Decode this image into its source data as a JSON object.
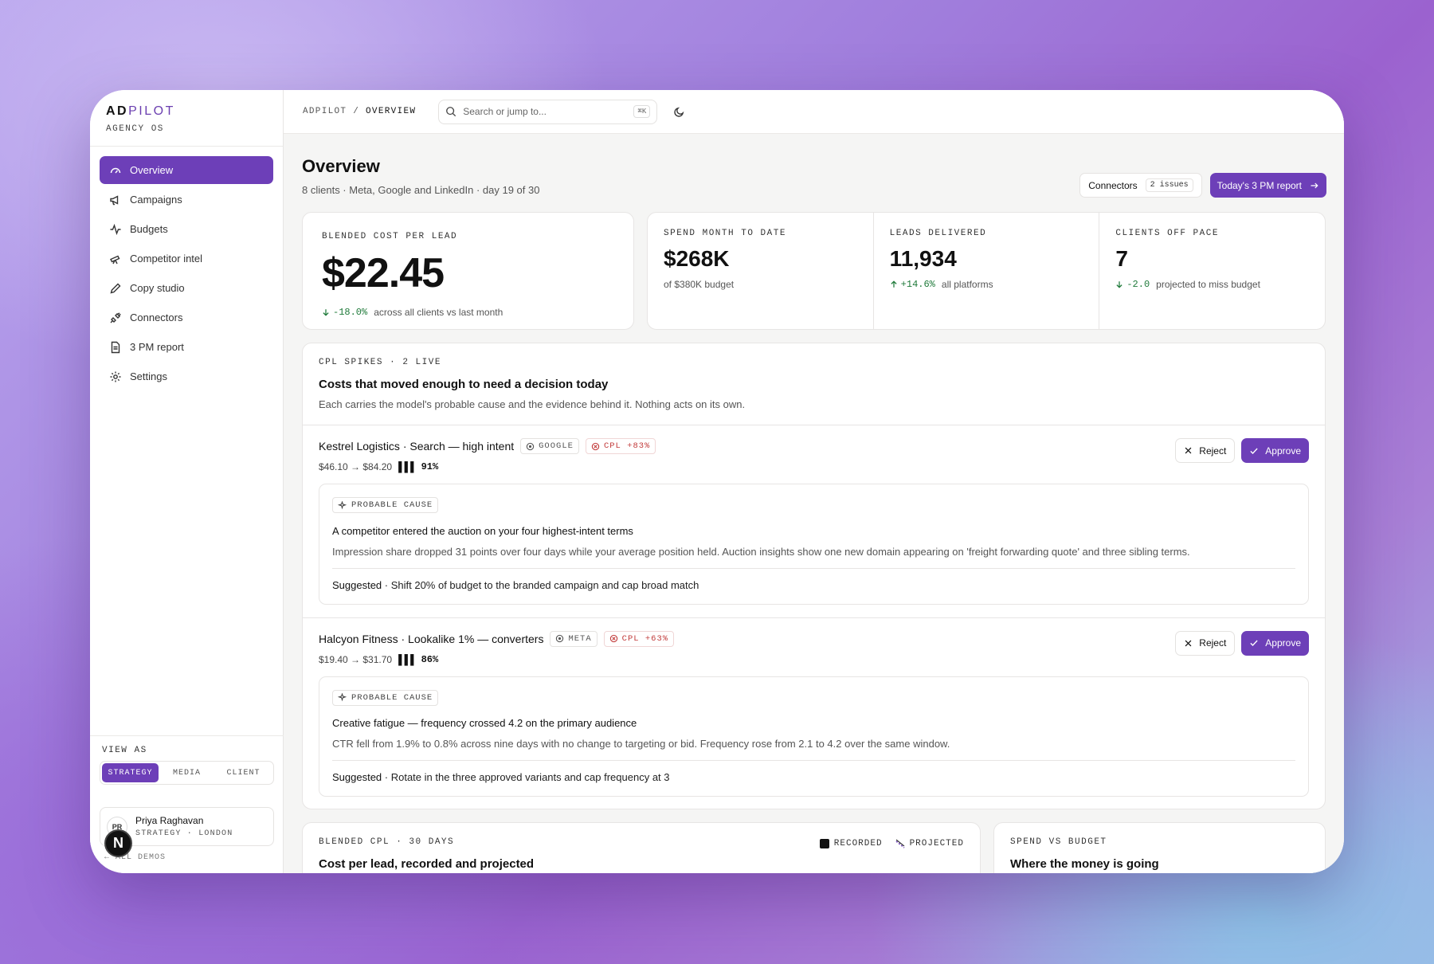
{
  "brand": {
    "name_a": "AD",
    "name_b": "PILOT",
    "tagline": "AGENCY OS"
  },
  "nav": [
    {
      "label": "Overview",
      "icon": "gauge-icon",
      "active": true
    },
    {
      "label": "Campaigns",
      "icon": "megaphone-icon"
    },
    {
      "label": "Budgets",
      "icon": "activity-icon"
    },
    {
      "label": "Competitor intel",
      "icon": "telescope-icon"
    },
    {
      "label": "Copy studio",
      "icon": "pen-icon"
    },
    {
      "label": "Connectors",
      "icon": "plug-icon"
    },
    {
      "label": "3 PM report",
      "icon": "document-icon"
    },
    {
      "label": "Settings",
      "icon": "gear-icon"
    }
  ],
  "view_as": {
    "label": "VIEW AS",
    "options": [
      "STRATEGY",
      "MEDIA",
      "CLIENT"
    ],
    "selected": "STRATEGY"
  },
  "user": {
    "initials": "PR",
    "name": "Priya Raghavan",
    "role": "STRATEGY · LONDON"
  },
  "all_demos": "ALL DEMOS",
  "badge_letter": "N",
  "topbar": {
    "crumb_root": "ADPILOT",
    "crumb_sep": " / ",
    "crumb_page": "OVERVIEW",
    "search_placeholder": "Search or jump to...",
    "shortcut": "⌘K"
  },
  "header": {
    "title": "Overview",
    "subtitle": "8 clients · Meta, Google and LinkedIn · day 19 of 30",
    "connectors_label": "Connectors",
    "connectors_issues": "2 issues",
    "report_button": "Today's 3 PM report"
  },
  "kpis": {
    "cpl": {
      "label": "BLENDED COST PER LEAD",
      "value": "$22.45",
      "delta": "-18.0%",
      "note": "across all clients vs last month"
    },
    "spend": {
      "label": "SPEND MONTH TO DATE",
      "value": "$268K",
      "note": "of $380K budget"
    },
    "leads": {
      "label": "LEADS DELIVERED",
      "value": "11,934",
      "delta": "+14.6%",
      "note": "all platforms"
    },
    "offpace": {
      "label": "CLIENTS OFF PACE",
      "value": "7",
      "delta": "-2.0",
      "note": "projected to miss budget"
    }
  },
  "spikes": {
    "eyebrow": "CPL SPIKES · 2 LIVE",
    "title": "Costs that moved enough to need a decision today",
    "desc": "Each carries the model's probable cause and the evidence behind it. Nothing acts on its own.",
    "items": [
      {
        "name": "Kestrel Logistics · Search — high intent",
        "platform": "GOOGLE",
        "cpl": "CPL +83%",
        "range": "$46.10 → $84.20",
        "confidence": "91%",
        "cause_tag": "PROBABLE CAUSE",
        "cause_head": "A competitor entered the auction on your four highest-intent terms",
        "cause_body": "Impression share dropped 31 points over four days while your average position held. Auction insights show one new domain appearing on 'freight forwarding quote' and three sibling terms.",
        "suggested_label": "Suggested",
        "suggested": " · Shift 20% of budget to the branded campaign and cap broad match"
      },
      {
        "name": "Halcyon Fitness · Lookalike 1% — converters",
        "platform": "META",
        "cpl": "CPL +63%",
        "range": "$19.40 → $31.70",
        "confidence": "86%",
        "cause_tag": "PROBABLE CAUSE",
        "cause_head": "Creative fatigue — frequency crossed 4.2 on the primary audience",
        "cause_body": "CTR fell from 1.9% to 0.8% across nine days with no change to targeting or bid. Frequency rose from 2.1 to 4.2 over the same window.",
        "suggested_label": "Suggested",
        "suggested": " · Rotate in the three approved variants and cap frequency at 3"
      }
    ],
    "reject": "Reject",
    "approve": "Approve"
  },
  "cpl_chart": {
    "eyebrow": "BLENDED CPL · 30 DAYS",
    "title": "Cost per lead, recorded and projected",
    "legend_recorded": "RECORDED",
    "legend_projected": "PROJECTED"
  },
  "spend_chart": {
    "eyebrow": "SPEND VS BUDGET",
    "title": "Where the money is going"
  },
  "colors": {
    "accent": "#6d3fb8",
    "positive": "#1f7a3a",
    "negative": "#c23b3b"
  }
}
